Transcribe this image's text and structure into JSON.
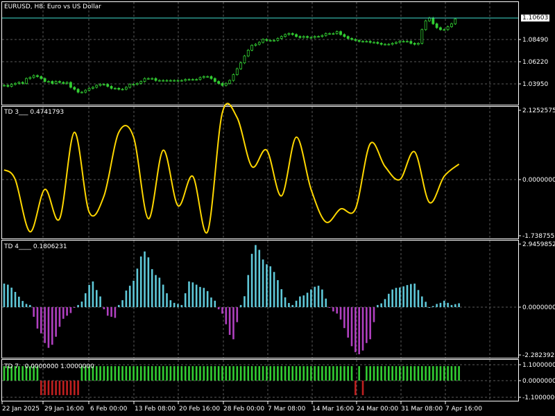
{
  "window": {
    "symbol_title": "EURUSD, H8:  Euro vs US Dollar",
    "current_price": "1.10603"
  },
  "panels": {
    "price": {
      "y_labels": [
        "1.08490",
        "1.06220",
        "1.03950"
      ],
      "y_values": [
        1.0849,
        1.0622,
        1.0395
      ]
    },
    "td3": {
      "name": "TD 3___",
      "value": "0.4741793",
      "y_labels": [
        "2.1252575",
        "0.0000000",
        "-1.7387551"
      ]
    },
    "td4": {
      "name": "TD 4____",
      "value": "0.1806231",
      "y_labels": [
        "2.9459852",
        "0.0000000",
        "-2.2823923"
      ]
    },
    "td7": {
      "name": "TD 7",
      "value_a": "0.0000000",
      "value_b": "1.0000000",
      "y_labels": [
        "1.1000000",
        "0.0000000",
        "-1.1000000"
      ]
    }
  },
  "x_axis": {
    "labels": [
      "22 Jan 2025",
      "29 Jan 16:00",
      "6 Feb 00:00",
      "13 Feb 08:00",
      "20 Feb 16:00",
      "28 Feb 00:00",
      "7 Mar 08:00",
      "14 Mar 16:00",
      "24 Mar 00:00",
      "31 Mar 08:00",
      "7 Apr 16:00"
    ]
  },
  "colors": {
    "background": "#000000",
    "grid": "#5a5a5a",
    "candles": "#32cd32",
    "bid_line": "#40e0d0",
    "td3_line": "#ffd700",
    "td4_positive": "#5fc8d8",
    "td4_negative": "#b040c0",
    "td7_positive": "#32cd32",
    "td7_negative": "#c02020"
  },
  "chart_data": [
    {
      "type": "candlestick",
      "title": "EURUSD, H8:  Euro vs US Dollar",
      "ylim": [
        1.025,
        1.113
      ],
      "close": [
        1.038,
        1.037,
        1.039,
        1.04,
        1.041,
        1.04,
        1.045,
        1.046,
        1.048,
        1.047,
        1.045,
        1.042,
        1.042,
        1.04,
        1.042,
        1.041,
        1.04,
        1.041,
        1.036,
        1.034,
        1.031,
        1.031,
        1.033,
        1.035,
        1.036,
        1.038,
        1.039,
        1.039,
        1.037,
        1.035,
        1.035,
        1.034,
        1.034,
        1.036,
        1.039,
        1.039,
        1.04,
        1.042,
        1.045,
        1.045,
        1.045,
        1.043,
        1.043,
        1.043,
        1.043,
        1.043,
        1.043,
        1.043,
        1.043,
        1.044,
        1.044,
        1.044,
        1.044,
        1.046,
        1.047,
        1.047,
        1.045,
        1.042,
        1.04,
        1.038,
        1.04,
        1.043,
        1.049,
        1.055,
        1.061,
        1.068,
        1.074,
        1.079,
        1.08,
        1.082,
        1.085,
        1.084,
        1.084,
        1.084,
        1.086,
        1.088,
        1.09,
        1.091,
        1.09,
        1.088,
        1.087,
        1.088,
        1.087,
        1.087,
        1.088,
        1.088,
        1.089,
        1.091,
        1.091,
        1.091,
        1.093,
        1.09,
        1.088,
        1.086,
        1.085,
        1.084,
        1.083,
        1.083,
        1.083,
        1.082,
        1.082,
        1.081,
        1.08,
        1.08,
        1.08,
        1.081,
        1.082,
        1.083,
        1.083,
        1.083,
        1.081,
        1.08,
        1.081,
        1.095,
        1.104,
        1.107,
        1.101,
        1.097,
        1.095,
        1.095,
        1.098,
        1.101,
        1.106
      ]
    },
    {
      "type": "line",
      "name": "TD 3___",
      "ylim": [
        -1.7387551,
        2.1252575
      ],
      "x": [
        0,
        3,
        7,
        11,
        15,
        19,
        23,
        27,
        31,
        35,
        39,
        43,
        47,
        51,
        55,
        59,
        63,
        67,
        71,
        75,
        79,
        83,
        87,
        91,
        95,
        99,
        103,
        107,
        111,
        115,
        119,
        123
      ],
      "values": [
        0.3,
        0.0,
        -1.6,
        -0.3,
        -1.2,
        1.45,
        -1.0,
        -0.5,
        1.45,
        1.3,
        -1.2,
        0.9,
        -0.8,
        0.1,
        -1.6,
        2.05,
        1.9,
        0.4,
        0.9,
        -0.5,
        1.3,
        -0.3,
        -1.3,
        -0.9,
        -0.9,
        1.1,
        0.4,
        0.0,
        0.85,
        -0.7,
        0.1,
        0.474
      ]
    },
    {
      "type": "bar",
      "name": "TD 4____",
      "ylim": [
        -2.2823923,
        2.9459852
      ],
      "x": [
        0,
        7,
        9,
        12,
        17,
        20,
        24,
        25,
        28,
        30,
        31,
        34,
        38,
        41,
        46,
        48,
        50,
        54,
        57,
        58,
        62,
        64,
        68,
        71,
        78,
        80,
        85,
        89,
        96,
        99,
        101,
        106,
        111,
        113,
        115,
        118,
        119,
        121,
        123
      ],
      "values": [
        1.1,
        0.1,
        -1.0,
        -1.9,
        -0.4,
        0.1,
        1.2,
        0.8,
        -0.4,
        -0.5,
        0.1,
        1.0,
        2.6,
        1.5,
        0.2,
        0.1,
        1.2,
        0.9,
        0.3,
        -0.1,
        -1.5,
        0.1,
        2.9,
        2.0,
        0.1,
        0.5,
        1.0,
        -0.2,
        -2.2,
        -1.5,
        0.1,
        0.9,
        1.1,
        0.5,
        0.0,
        0.2,
        0.3,
        0.1,
        0.18
      ]
    },
    {
      "type": "bar",
      "name": "TD 7",
      "ylim": [
        -1.1,
        1.1
      ],
      "segments": [
        {
          "from": 0,
          "to": 9,
          "value": 1
        },
        {
          "from": 10,
          "to": 20,
          "value": -1
        },
        {
          "from": 21,
          "to": 94,
          "value": 1
        },
        {
          "from": 95,
          "to": 95,
          "value": -1
        },
        {
          "from": 96,
          "to": 96,
          "value": 1
        },
        {
          "from": 97,
          "to": 97,
          "value": -1
        },
        {
          "from": 98,
          "to": 123,
          "value": 1
        }
      ]
    }
  ]
}
